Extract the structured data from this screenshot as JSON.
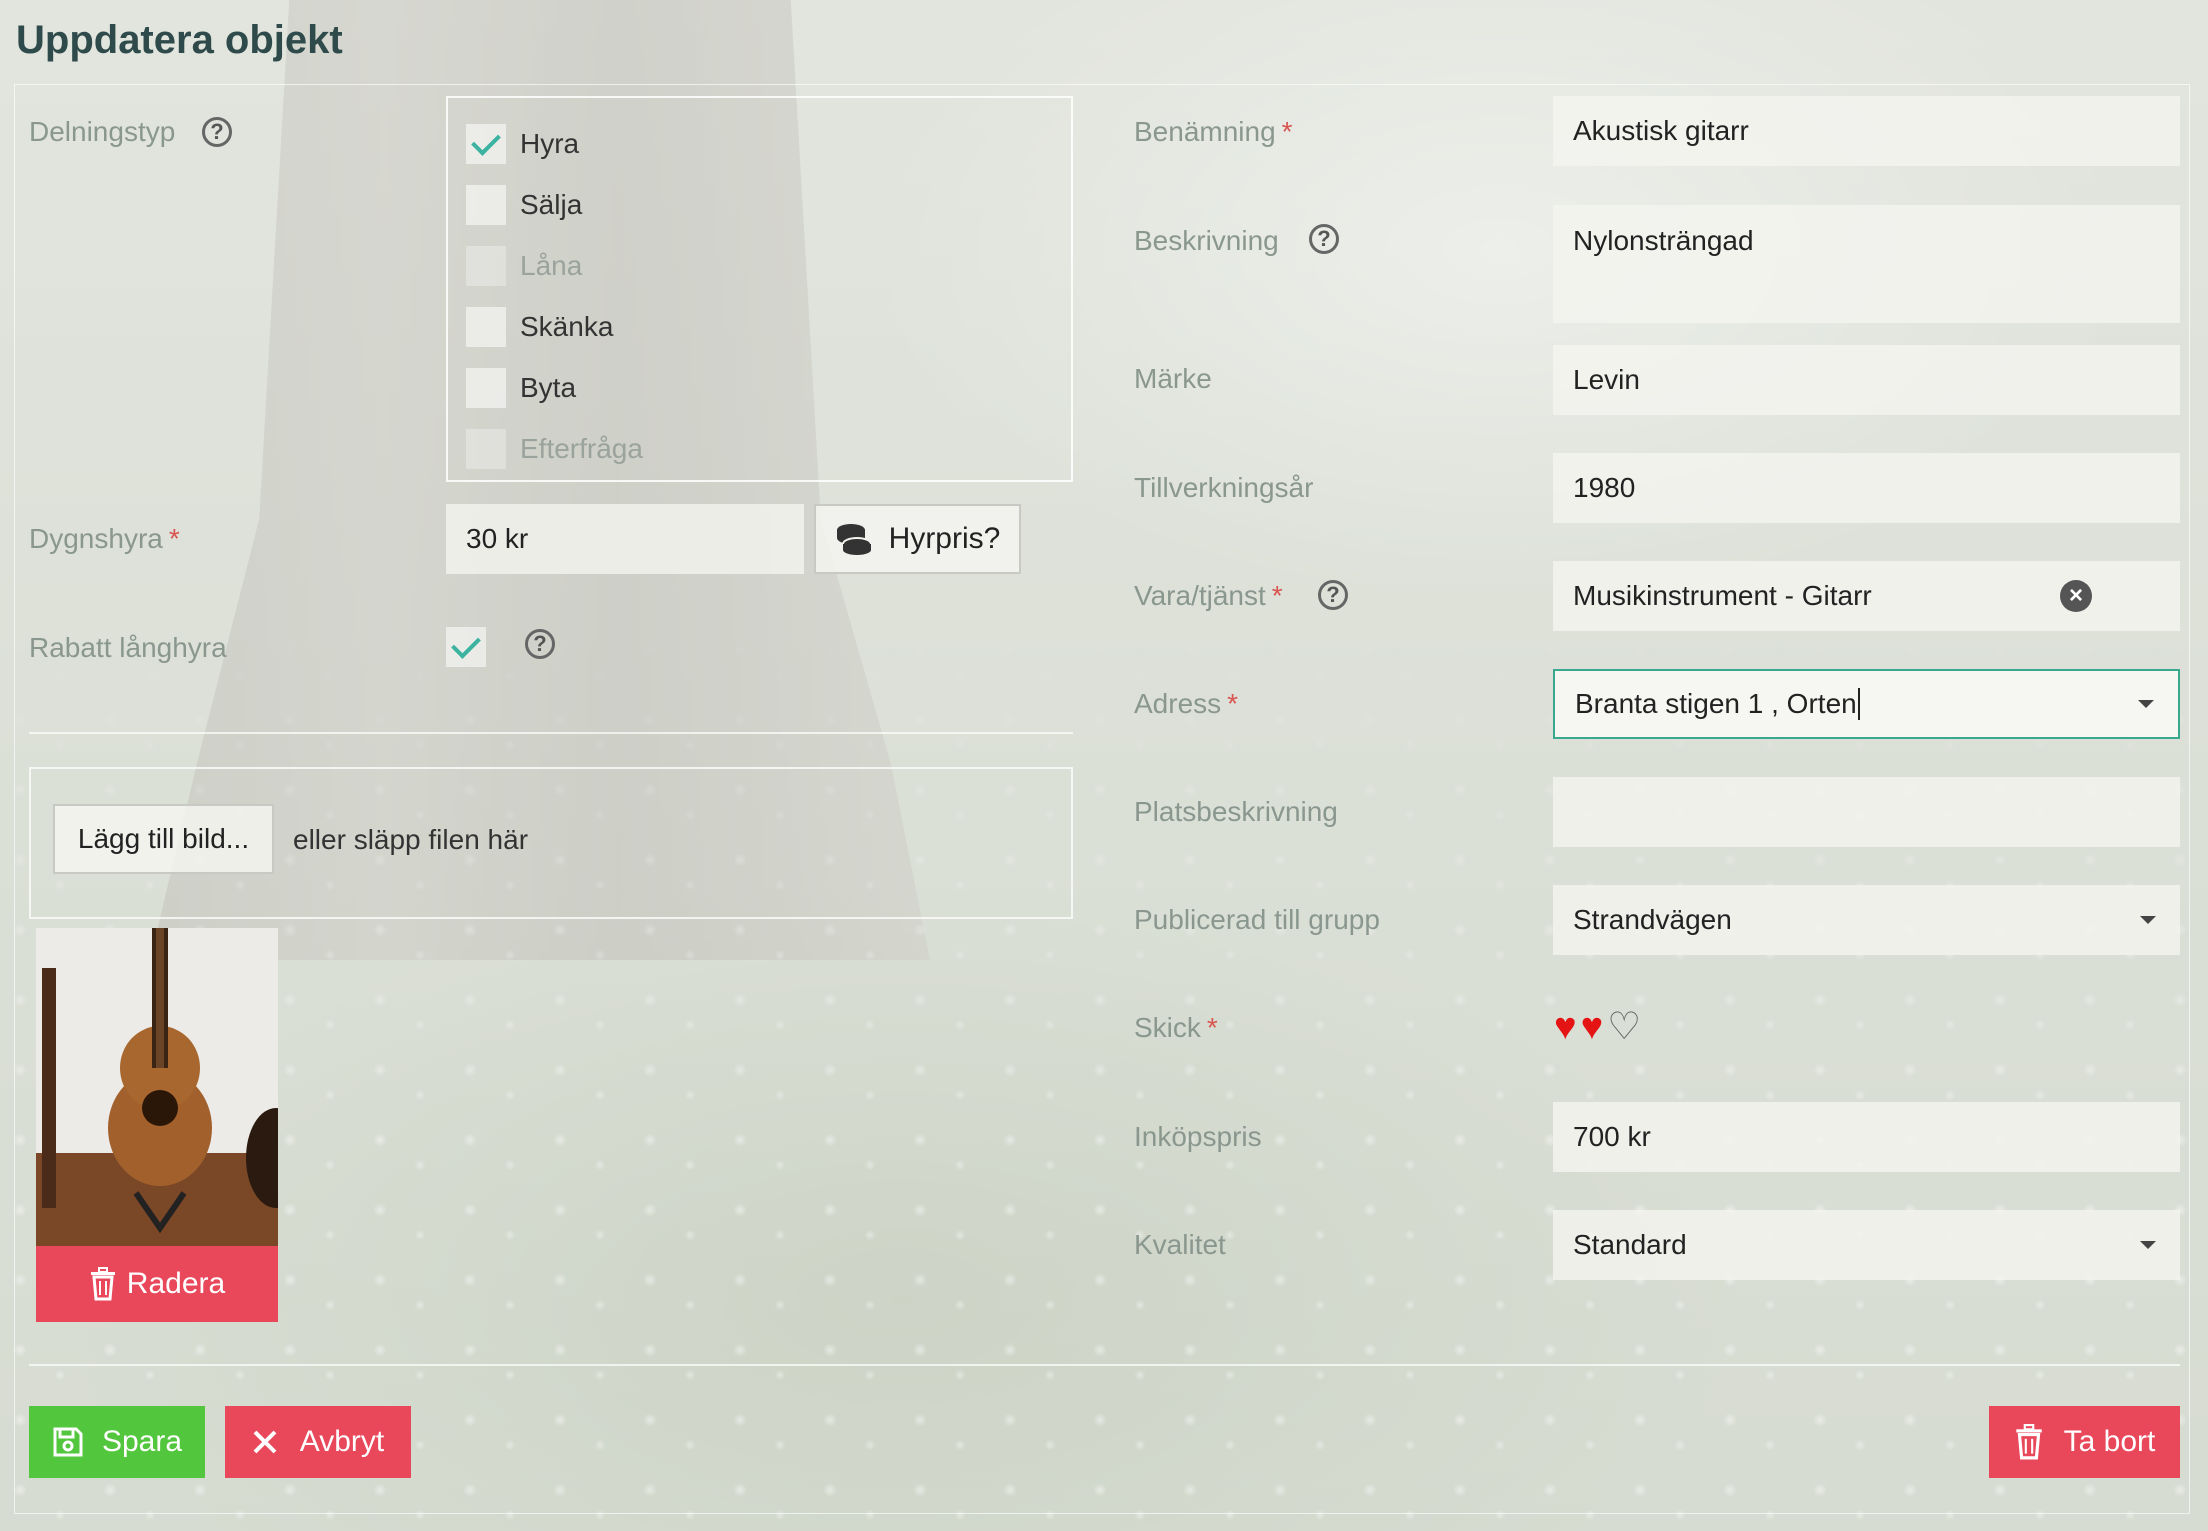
{
  "title": "Uppdatera objekt",
  "left": {
    "delningstyp_label": "Delningstyp",
    "share_types": [
      {
        "label": "Hyra",
        "checked": true,
        "disabled": false
      },
      {
        "label": "Sälja",
        "checked": false,
        "disabled": false
      },
      {
        "label": "Låna",
        "checked": false,
        "disabled": true
      },
      {
        "label": "Skänka",
        "checked": false,
        "disabled": false
      },
      {
        "label": "Byta",
        "checked": false,
        "disabled": false
      },
      {
        "label": "Efterfråga",
        "checked": false,
        "disabled": true
      }
    ],
    "dygnshyra_label": "Dygnshyra",
    "dygnshyra_value": "30 kr",
    "hyrpris_button": "Hyrpris?",
    "rabatt_label": "Rabatt långhyra",
    "rabatt_checked": true,
    "add_image_button": "Lägg till bild...",
    "drop_text": "eller släpp filen här",
    "delete_image_button": "Radera"
  },
  "right": {
    "benamning_label": "Benämning",
    "benamning_value": "Akustisk gitarr",
    "beskrivning_label": "Beskrivning",
    "beskrivning_value": "Nylonsträngad",
    "marke_label": "Märke",
    "marke_value": "Levin",
    "tillverkningsar_label": "Tillverkningsår",
    "tillverkningsar_value": "1980",
    "vara_label": "Vara/tjänst",
    "vara_value": "Musikinstrument - Gitarr",
    "adress_label": "Adress",
    "adress_value": "Branta stigen 1 , Orten",
    "platsbeskrivning_label": "Platsbeskrivning",
    "platsbeskrivning_value": "",
    "grupp_label": "Publicerad till grupp",
    "grupp_value": "Strandvägen",
    "skick_label": "Skick",
    "skick_rating": 2,
    "skick_max": 3,
    "inkopspris_label": "Inköpspris",
    "inkopspris_value": "700 kr",
    "kvalitet_label": "Kvalitet",
    "kvalitet_value": "Standard"
  },
  "footer": {
    "save_button": "Spara",
    "cancel_button": "Avbryt",
    "delete_button": "Ta bort"
  },
  "colors": {
    "save": "#52c63c",
    "danger": "#e8485a",
    "accent": "#3bb3a0",
    "required": "#d9534f"
  }
}
